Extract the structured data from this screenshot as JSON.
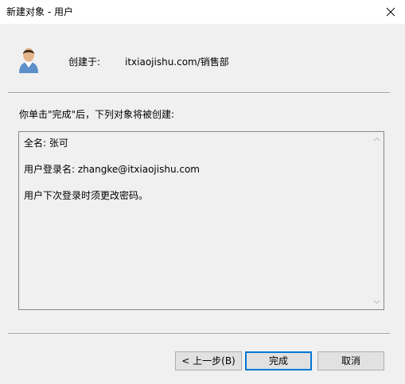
{
  "window": {
    "title": "新建对象 - 用户"
  },
  "header": {
    "created_label": "创建于:",
    "created_value": "itxiaojishu.com/销售部",
    "icon": "user-icon"
  },
  "intro_text": "你单击\"完成\"后，下列对象将被创建:",
  "summary": {
    "full_name": "全名: 张可",
    "logon_name": "用户登录名: zhangke@itxiaojishu.com",
    "password_note": "用户下次登录时须更改密码。"
  },
  "buttons": {
    "back": "< 上一步(B)",
    "finish": "完成",
    "cancel": "取消"
  },
  "colors": {
    "background": "#f0f0f0",
    "accent": "#0078d7"
  }
}
